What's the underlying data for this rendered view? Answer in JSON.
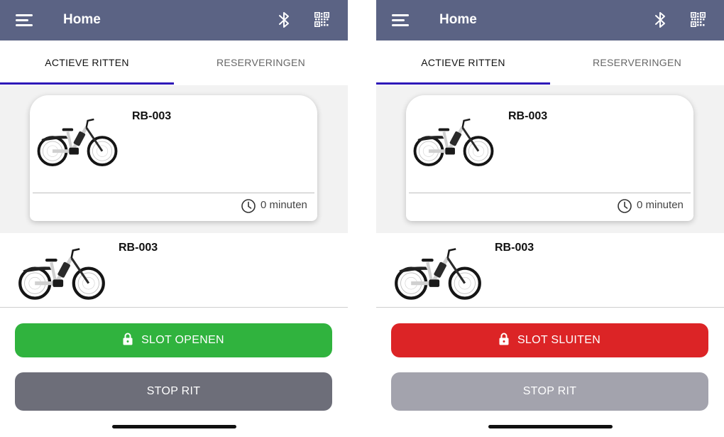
{
  "screens": [
    {
      "appbar": {
        "title": "Home",
        "menu_icon": "hamburger-icon",
        "bluetooth_icon": "bluetooth-icon",
        "qr_icon": "qr-code-icon"
      },
      "tabs": [
        {
          "label": "ACTIEVE RITTEN",
          "active": true
        },
        {
          "label": "RESERVERINGEN",
          "active": false
        }
      ],
      "ride_card": {
        "bike_id": "RB-003",
        "duration": "0 minuten",
        "clock_icon": "clock-icon"
      },
      "detail": {
        "bike_id": "RB-003"
      },
      "lock_button": {
        "label": "SLOT OPENEN",
        "color": "#30b33e",
        "icon": "padlock-icon"
      },
      "stop_button": {
        "label": "STOP RIT",
        "color": "#6d6e79",
        "enabled": true
      }
    },
    {
      "appbar": {
        "title": "Home",
        "menu_icon": "hamburger-icon",
        "bluetooth_icon": "bluetooth-icon",
        "qr_icon": "qr-code-icon"
      },
      "tabs": [
        {
          "label": "ACTIEVE RITTEN",
          "active": true
        },
        {
          "label": "RESERVERINGEN",
          "active": false
        }
      ],
      "ride_card": {
        "bike_id": "RB-003",
        "duration": "0 minuten",
        "clock_icon": "clock-icon"
      },
      "detail": {
        "bike_id": "RB-003"
      },
      "lock_button": {
        "label": "SLOT SLUITEN",
        "color": "#dc2426",
        "icon": "padlock-icon"
      },
      "stop_button": {
        "label": "STOP RIT",
        "color": "#a3a3ad",
        "enabled": false
      }
    }
  ],
  "colors": {
    "appbar": "#5b6384",
    "tab_indicator": "#2f19b8"
  }
}
